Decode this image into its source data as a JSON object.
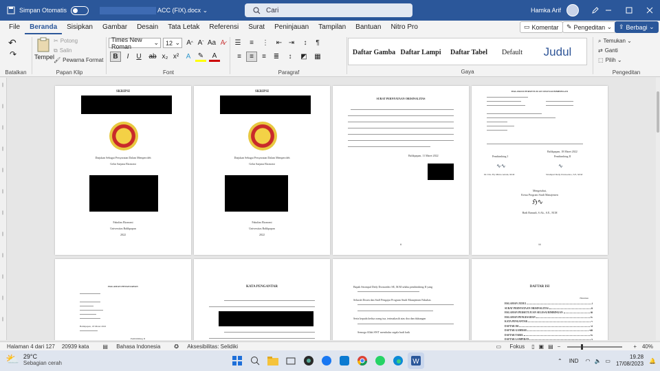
{
  "titlebar": {
    "autosave_label": "Simpan Otomatis",
    "doc_name": "ACC (FIX).docx",
    "search_placeholder": "Cari",
    "user_name": "Hamka Arif"
  },
  "menu": [
    "File",
    "Beranda",
    "Sisipkan",
    "Gambar",
    "Desain",
    "Tata Letak",
    "Referensi",
    "Surat",
    "Peninjauan",
    "Tampilan",
    "Bantuan",
    "Nitro Pro"
  ],
  "ribbon_buttons": {
    "comment": "Komentar",
    "editing": "Pengeditan",
    "share": "Berbagi"
  },
  "ribbon": {
    "undo_group": "Batalkan",
    "clipboard": {
      "paste": "Tempel",
      "cut": "Potong",
      "copy": "Salin",
      "format_painter": "Pewarna Format",
      "label": "Papan Klip"
    },
    "font": {
      "name": "Times New Roman",
      "size": "12",
      "label": "Font"
    },
    "paragraph_label": "Paragraf",
    "styles": {
      "items": [
        "Daftar Gamba",
        "Daftar Lampi",
        "Daftar Tabel",
        "Default",
        "Judul"
      ],
      "label": "Gaya"
    },
    "editing": {
      "find": "Temukan",
      "replace": "Ganti",
      "select": "Pilih",
      "label": "Pengeditan"
    }
  },
  "pages": {
    "p1": {
      "title": "SKRIPSI",
      "sub1": "Diajukan Sebagai Persyaratan Dalam Memperoleh",
      "sub2": "Gelar Sarjana Ekonomi",
      "fac": "Fakultas Ekonomi",
      "uni": "Universitas Balikpapan",
      "year": "2022"
    },
    "p2": {
      "title": "SKRIPSI",
      "sub1": "Diajukan Sebagai Persyaratan Dalam Memperoleh",
      "sub2": "Gelar Sarjana Ekonomi",
      "fac": "Fakultas Ekonomi",
      "uni": "Universitas Balikpapan",
      "year": "2022"
    },
    "p3": {
      "title": "SURAT PERNYATAAN ORISINALITAS",
      "date": "Balikpapan, 11 Maret 2022",
      "num": "ii"
    },
    "p4": {
      "title": "HALAMAN PERSETUJUAN SELESAI BIMBINGAN",
      "date": "Balikpapan, 18 Maret 2022",
      "p1": "Pembimbing I",
      "p2": "Pembimbing II",
      "s1": "Dr. Drs. Hj. Mirna Ariani, M.M",
      "s2": "Sitompul Dedy Dornoedeo, S.E, M.M",
      "acc": "Mengetahui,",
      "kaprodi": "Ketua Program Studi Manajemen",
      "kname": "Hadi Ramadi, S.Ak., S.E., M.M",
      "num": "iii"
    },
    "p5": {
      "title": "HALAMAN PENGESAHAN",
      "date": "Balikpapan, 18 Maret 2022",
      "p2": "Pembimbing II"
    },
    "p6": {
      "title": "KATA PENGANTAR"
    },
    "p7": {
      "lines": [
        "Bapak Sitompul Dedy Dornoedeo SE, M.M selaku pembimbing II yang",
        "Seluruh Dosen dan Staff Pengajar Program Studi Manajemen Fakultas",
        "Serta kepada kedua orang tua, terimakasih atas doa dan dukungan",
        "Semoga Allah SWT membalas segala budi baik"
      ]
    },
    "p8": {
      "title": "DAFTAR ISI",
      "hal": "Halaman",
      "toc": [
        "HALAMAN JUDUL",
        "SURAT PERNYATAAN ORISINALITAS",
        "HALAMAN PERSETUJUAN SELESAI BIMBINGAN",
        "HALAMAN PENGESAHAN",
        "KATA PENGANTAR",
        "DAFTAR ISI",
        "DAFTAR GAMBAR",
        "DAFTAR TABEL",
        "DAFTAR LAMPIRAN"
      ],
      "nums": [
        "i",
        "ii",
        "iii",
        "iv",
        "v",
        "vi",
        "viii",
        "ix",
        "x"
      ]
    }
  },
  "status": {
    "page": "Halaman 4 dari 127",
    "words": "20939 kata",
    "lang": "Bahasa Indonesia",
    "access": "Aksesibilitas: Selidiki",
    "focus": "Fokus",
    "zoom": "40%"
  },
  "taskbar": {
    "temp": "29°C",
    "weather": "Sebagian cerah",
    "lang": "IND",
    "time": "19.28",
    "date": "17/08/2023"
  },
  "colors": {
    "word_blue": "#2b579a"
  }
}
